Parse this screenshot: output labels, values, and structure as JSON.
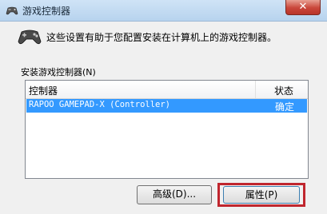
{
  "window": {
    "title": "游戏控制器",
    "close_label": "✕"
  },
  "description": "这些设置有助于您配置安装在计算机上的游戏控制器。",
  "section_label": "安装游戏控制器(N)",
  "list": {
    "columns": [
      "控制器",
      "状态"
    ],
    "rows": [
      {
        "controller": "RAPOO GAMEPAD-X (Controller)",
        "status": "确定",
        "selected": true
      }
    ]
  },
  "buttons": {
    "advanced": "高级(D)...",
    "properties": "属性(P)"
  },
  "colors": {
    "selection": "#3399ff",
    "highlight_frame": "#c0262e"
  }
}
